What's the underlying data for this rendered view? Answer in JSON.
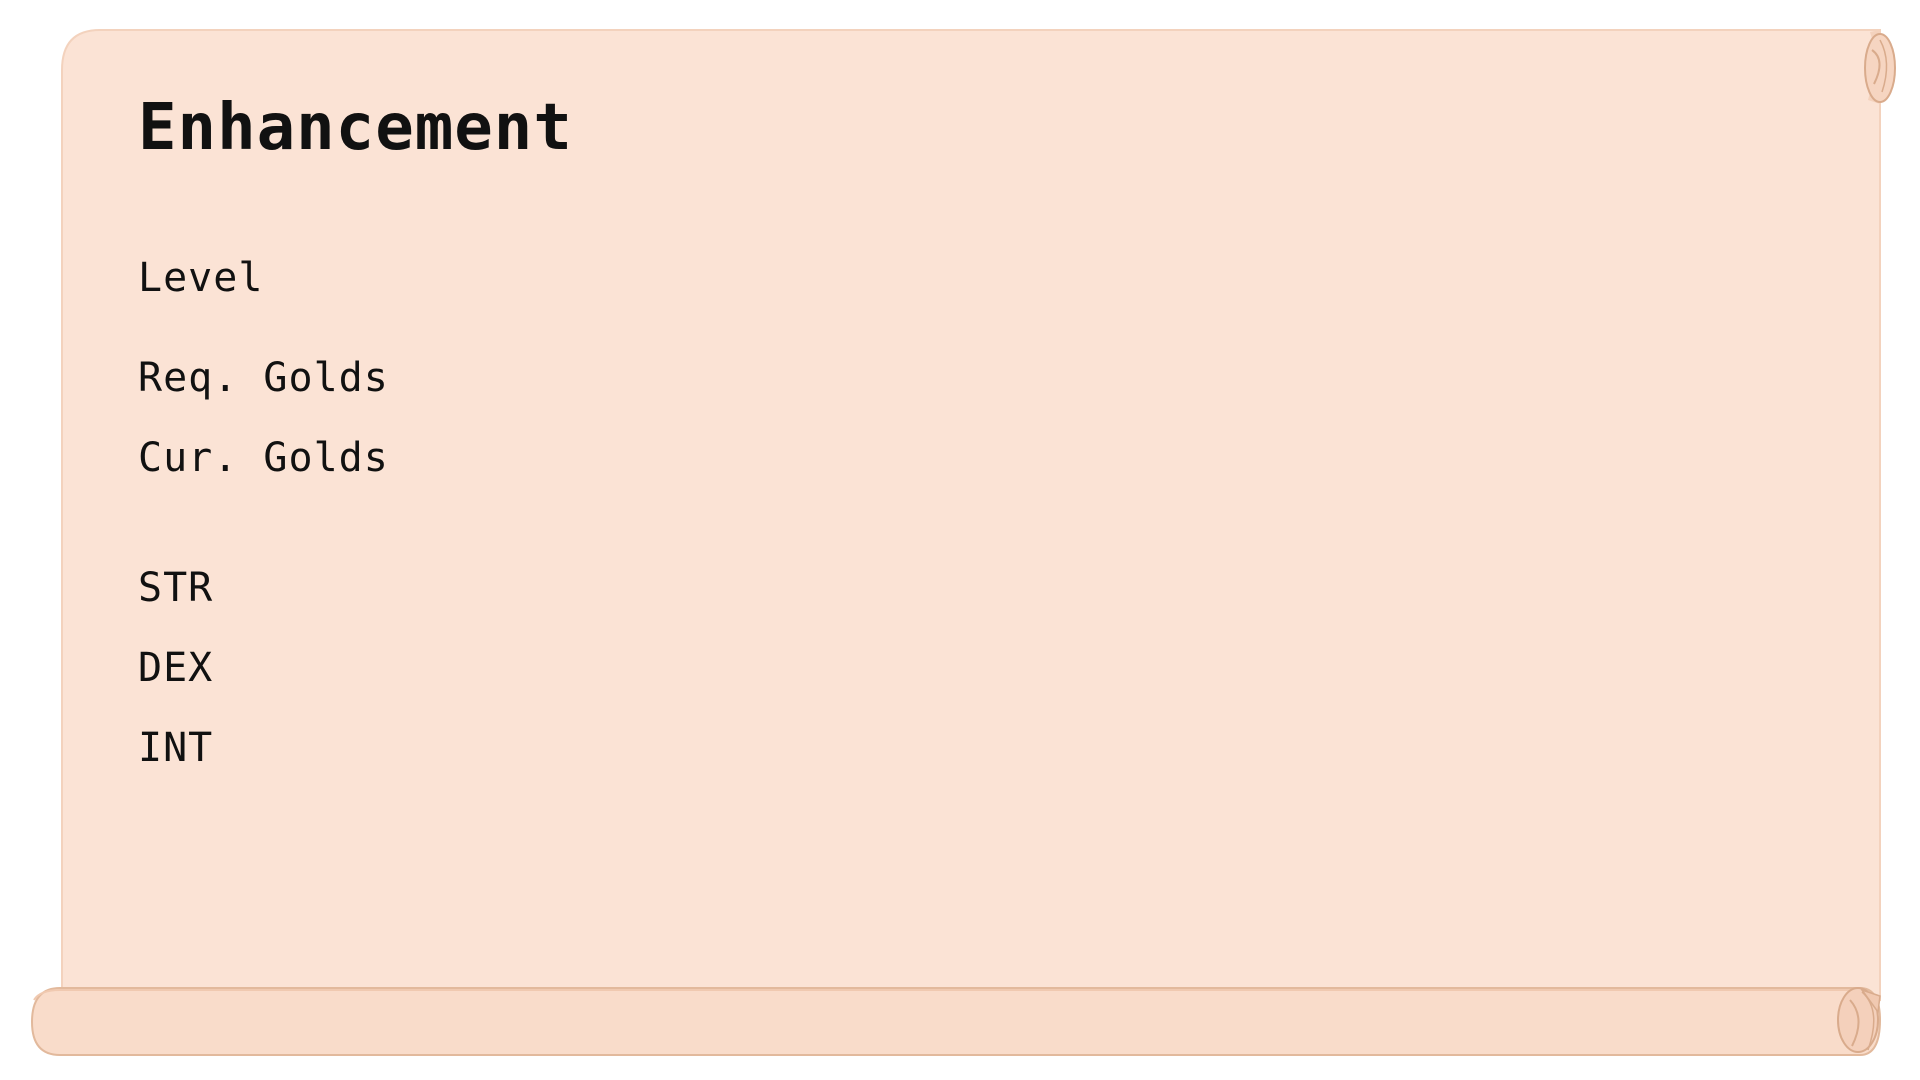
{
  "panel": {
    "title": "Enhancement",
    "colors": {
      "parchment": "#fbe3d5",
      "parchment_edge": "#e7c2a6",
      "roll": "#f9dcca",
      "text": "#111111"
    }
  },
  "rows": [
    {
      "key": "level",
      "label": "Level",
      "value": ""
    },
    {
      "key": "req_golds",
      "label": "Req. Golds",
      "value": ""
    },
    {
      "key": "cur_golds",
      "label": "Cur. Golds",
      "value": ""
    },
    {
      "key": "str",
      "label": "STR",
      "value": ""
    },
    {
      "key": "dex",
      "label": "DEX",
      "value": ""
    },
    {
      "key": "int",
      "label": "INT",
      "value": ""
    }
  ]
}
